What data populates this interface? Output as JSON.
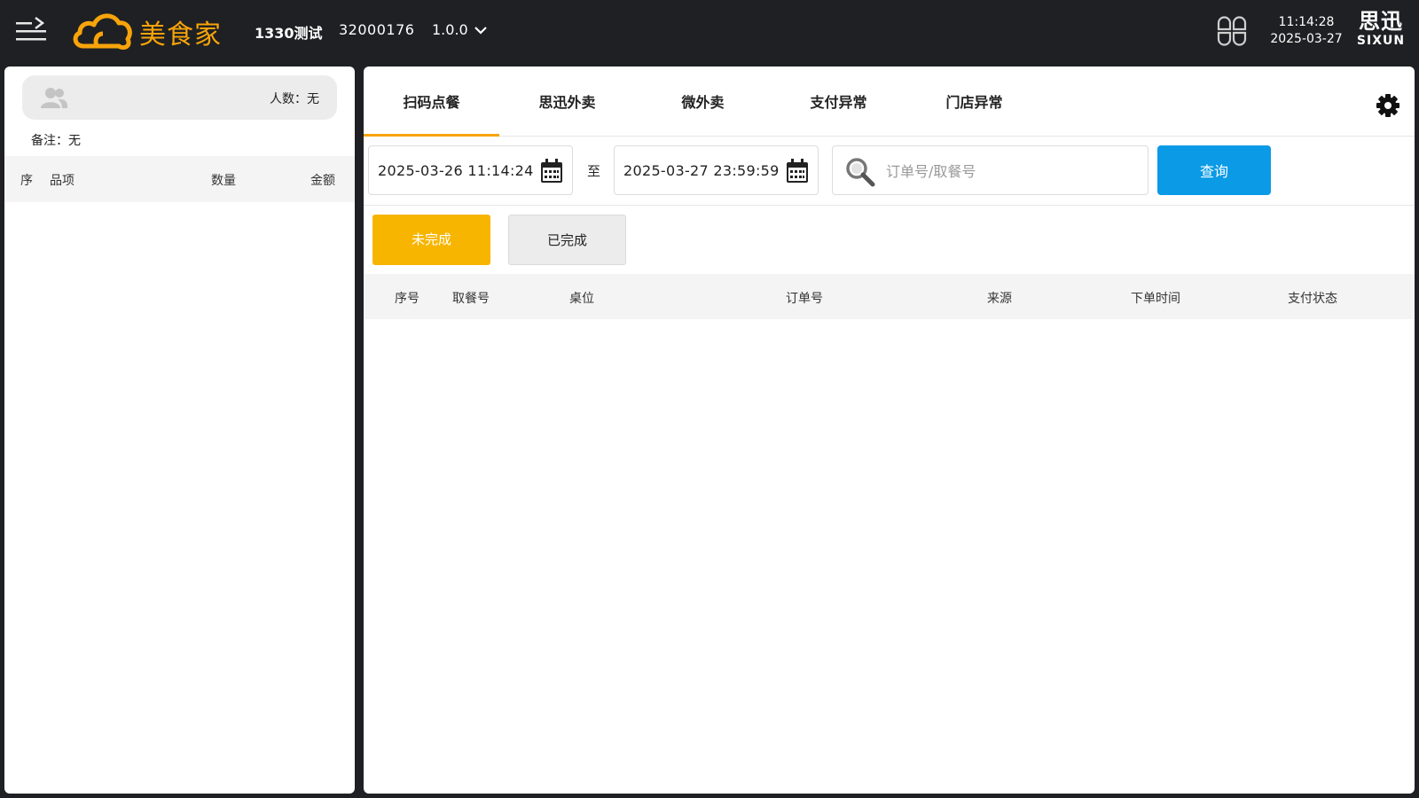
{
  "header": {
    "brand": "美食家",
    "store_name": "1330测试",
    "store_code": "32000176",
    "version": "1.0.0",
    "time": "11:14:28",
    "date": "2025-03-27",
    "logo_cn": "思迅",
    "logo_en": "SIXUN"
  },
  "left_panel": {
    "people_count": "人数：无",
    "remark": "备注：无",
    "columns": [
      "序",
      "品项",
      "数量",
      "金额"
    ]
  },
  "tabs": [
    "扫码点餐",
    "思迅外卖",
    "微外卖",
    "支付异常",
    "门店异常"
  ],
  "filters": {
    "start_date": "2025-03-26 11:14:24",
    "to": "至",
    "end_date": "2025-03-27 23:59:59",
    "search_placeholder": "订单号/取餐号",
    "query_label": "查询"
  },
  "status_buttons": [
    "未完成",
    "已完成"
  ],
  "order_table": {
    "columns": [
      "序号",
      "取餐号",
      "桌位",
      "订单号",
      "来源",
      "下单时间",
      "支付状态"
    ]
  },
  "colors": {
    "accent": "#f7a40a",
    "primary_button": "#0a9ae6",
    "active_status": "#f7b500",
    "topbar": "#1f2023"
  }
}
